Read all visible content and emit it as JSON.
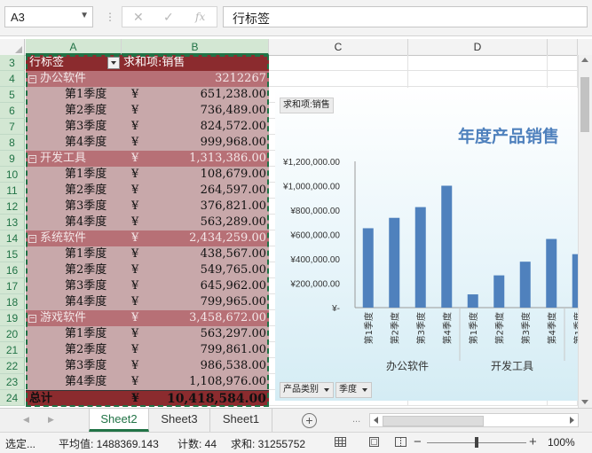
{
  "formula_bar": {
    "name_box": "A3",
    "cancel_glyph": "✕",
    "enter_glyph": "✓",
    "fx_glyph": "fx",
    "content": "行标签"
  },
  "columns": [
    "A",
    "B",
    "C",
    "D"
  ],
  "pivot": {
    "header": {
      "label": "行标签",
      "value_header": "求和项:销售"
    },
    "groups": [
      {
        "name": "办公软件",
        "subtotal": "3212267",
        "subtotal_currency": "",
        "rows": [
          {
            "quarter": "第1季度",
            "currency": "¥",
            "amount": "651,238.00"
          },
          {
            "quarter": "第2季度",
            "currency": "¥",
            "amount": "736,489.00"
          },
          {
            "quarter": "第3季度",
            "currency": "¥",
            "amount": "824,572.00"
          },
          {
            "quarter": "第4季度",
            "currency": "¥",
            "amount": "999,968.00"
          }
        ]
      },
      {
        "name": "开发工具",
        "subtotal": "1,313,386.00",
        "subtotal_currency": "¥",
        "rows": [
          {
            "quarter": "第1季度",
            "currency": "¥",
            "amount": "108,679.00"
          },
          {
            "quarter": "第2季度",
            "currency": "¥",
            "amount": "264,597.00"
          },
          {
            "quarter": "第3季度",
            "currency": "¥",
            "amount": "376,821.00"
          },
          {
            "quarter": "第4季度",
            "currency": "¥",
            "amount": "563,289.00"
          }
        ]
      },
      {
        "name": "系统软件",
        "subtotal": "2,434,259.00",
        "subtotal_currency": "¥",
        "rows": [
          {
            "quarter": "第1季度",
            "currency": "¥",
            "amount": "438,567.00"
          },
          {
            "quarter": "第2季度",
            "currency": "¥",
            "amount": "549,765.00"
          },
          {
            "quarter": "第3季度",
            "currency": "¥",
            "amount": "645,962.00"
          },
          {
            "quarter": "第4季度",
            "currency": "¥",
            "amount": "799,965.00"
          }
        ]
      },
      {
        "name": "游戏软件",
        "subtotal": "3,458,672.00",
        "subtotal_currency": "¥",
        "rows": [
          {
            "quarter": "第1季度",
            "currency": "¥",
            "amount": "563,297.00"
          },
          {
            "quarter": "第2季度",
            "currency": "¥",
            "amount": "799,861.00"
          },
          {
            "quarter": "第3季度",
            "currency": "¥",
            "amount": "986,538.00"
          },
          {
            "quarter": "第4季度",
            "currency": "¥",
            "amount": "1,108,976.00"
          }
        ]
      }
    ],
    "total": {
      "label": "总计",
      "currency": "¥",
      "amount": "10,418,584.00"
    },
    "expander_glyph": "−",
    "colors": {
      "header": "#8b2b2e",
      "group": "#b77076",
      "detail": "#c8a8aa"
    }
  },
  "row_numbers": [
    "3",
    "4",
    "5",
    "6",
    "7",
    "8",
    "9",
    "10",
    "11",
    "12",
    "13",
    "14",
    "15",
    "16",
    "17",
    "18",
    "19",
    "20",
    "21",
    "22",
    "23",
    "24"
  ],
  "chart_data": {
    "type": "bar",
    "title": "年度产品销售",
    "value_field_button": "求和项:销售",
    "y_ticks": [
      "¥-",
      "¥200,000.00",
      "¥400,000.00",
      "¥600,000.00",
      "¥800,000.00",
      "¥1,000,000.00",
      "¥1,200,000.00"
    ],
    "ylim": [
      0,
      1200000
    ],
    "groups": [
      {
        "name": "办公软件",
        "categories": [
          "第1季度",
          "第2季度",
          "第3季度",
          "第4季度"
        ],
        "values": [
          651238,
          736489,
          824572,
          999968
        ]
      },
      {
        "name": "开发工具",
        "categories": [
          "第1季度",
          "第2季度",
          "第3季度",
          "第4季度"
        ],
        "values": [
          108679,
          264597,
          376821,
          563289
        ]
      },
      {
        "name": "系统软件",
        "categories": [
          "第1季度",
          "第2季度",
          "第3季度",
          "第4季度"
        ],
        "values": [
          438567,
          549765,
          645962,
          799965
        ]
      },
      {
        "name": "游戏软件",
        "categories": [
          "第1季度",
          "第2季度",
          "第3季度",
          "第4季度"
        ],
        "values": [
          563297,
          799861,
          986538,
          1108976
        ]
      }
    ],
    "bar_color": "#4f81bd",
    "field_buttons": [
      "产品类别",
      "季度"
    ],
    "legend": "none",
    "grid": false
  },
  "sheet_tabs": {
    "tabs": [
      "Sheet2",
      "Sheet3",
      "Sheet1"
    ],
    "active": "Sheet2",
    "more_glyph": "..."
  },
  "status_bar": {
    "mode": "选定...",
    "average": "平均值: 1488369.143",
    "count": "计数: 44",
    "sum": "求和: 31255752",
    "zoom": "100%",
    "zoom_level_percent": 100
  },
  "accent_color": "#217346"
}
